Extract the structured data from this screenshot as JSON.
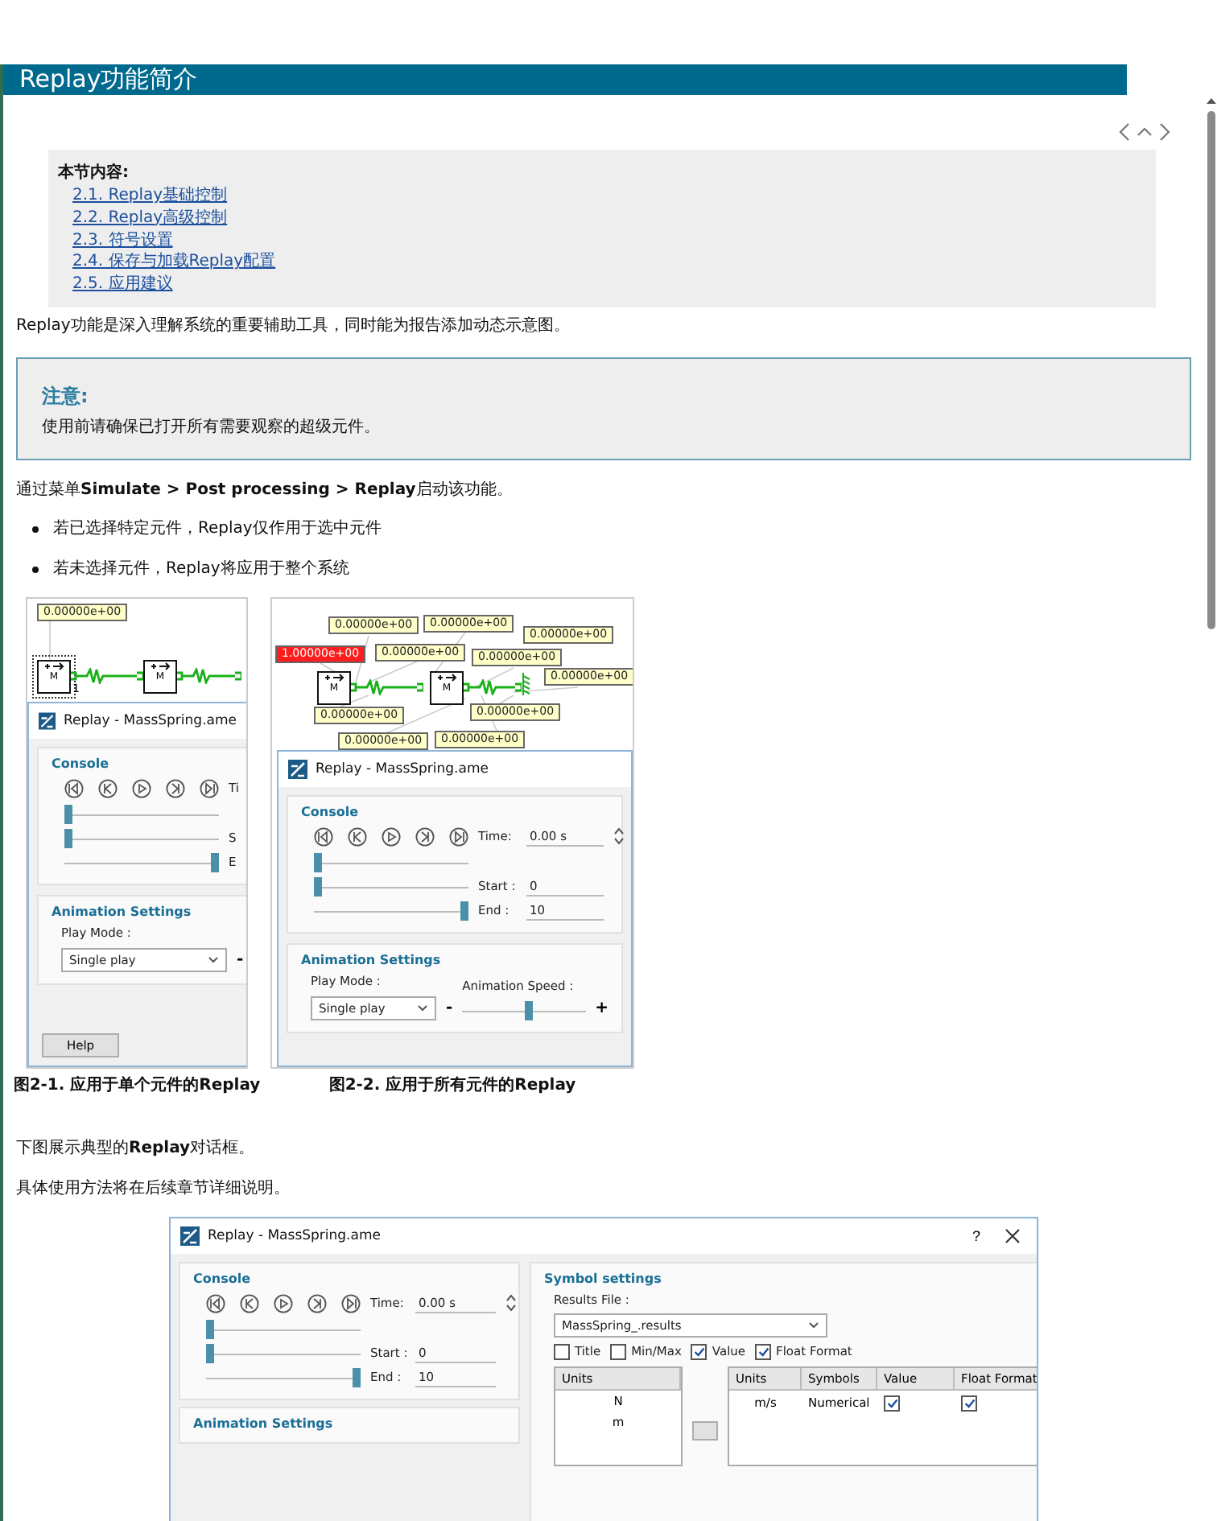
{
  "page_title": "Replay功能简介",
  "toc": {
    "heading": "本节内容:",
    "links": [
      "2.1. Replay基础控制",
      "2.2. Replay高级控制",
      "2.3. 符号设置",
      "2.4. 保存与加载Replay配置",
      "2.5. 应用建议"
    ]
  },
  "intro": "Replay功能是深入理解系统的重要辅助工具，同时能为报告添加动态示意图。",
  "note": {
    "title": "注意:",
    "text": "使用前请确保已打开所有需要观察的超级元件。"
  },
  "menu_path": "通过菜单**Simulate > Post processing > Replay**启动该功能。",
  "bullets": [
    "若已选择特定元件，Replay仅作用于选中元件",
    "若未选择元件，Replay将应用于整个系统"
  ],
  "figures": [
    {
      "caption": "图2-1. 应用于单个元件的Replay",
      "diagram": {
        "port_label": "1",
        "masses": [
          "M",
          "M"
        ],
        "values": [
          {
            "text": "0.00000e+00",
            "active": false
          }
        ]
      },
      "dialog": {
        "title": "Replay - MassSpring.ame",
        "close_button": false,
        "console": {
          "title": "Console",
          "time_label": "Ti",
          "start_label": "S",
          "end_label": "E",
          "sliders": [
            {
              "level": 0
            },
            {
              "level": 0
            },
            {
              "level": 1
            }
          ]
        },
        "animation": {
          "title": "Animation Settings",
          "play_mode_label": "Play Mode :",
          "play_mode": "Single play",
          "minus": "-"
        },
        "help_button": "Help"
      }
    },
    {
      "caption": "图2-2. 应用于所有元件的Replay",
      "diagram": {
        "masses": [
          "M",
          "M"
        ],
        "wall": true,
        "values": [
          {
            "text": "0.00000e+00",
            "active": false
          },
          {
            "text": "0.00000e+00",
            "active": false
          },
          {
            "text": "0.00000e+00",
            "active": false
          },
          {
            "text": "1.00000e+00",
            "active": true
          },
          {
            "text": "0.00000e+00",
            "active": false
          },
          {
            "text": "0.00000e+00",
            "active": false
          },
          {
            "text": "0.00000e+00",
            "active": false
          },
          {
            "text": "0.00000e+00",
            "active": false
          },
          {
            "text": "0.00000e+00",
            "active": false
          },
          {
            "text": "0.00000e+00",
            "active": false
          },
          {
            "text": "0.00000e+00",
            "active": false
          }
        ]
      },
      "dialog": {
        "title": "Replay - MassSpring.ame",
        "close_button": false,
        "console": {
          "title": "Console",
          "time_label": "Time:",
          "time_value": "0.00 s",
          "start_label": "Start :",
          "start_value": "0",
          "end_label": "End :",
          "end_value": "10",
          "sliders": [
            {
              "level": 0
            },
            {
              "level": 0
            },
            {
              "level": 1
            }
          ]
        },
        "animation": {
          "title": "Animation Settings",
          "play_mode_label": "Play Mode :",
          "play_mode": "Single play",
          "speed_label": "Animation Speed :",
          "minus": "-",
          "plus": "+",
          "speed_slider": {
            "level": 0.55
          }
        }
      }
    }
  ],
  "outro": [
    "下图展示典型的**Replay**对话框。",
    "具体使用方法将在后续章节详细说明。"
  ],
  "dialog": {
    "title": "Replay - MassSpring.ame",
    "help": "?",
    "close_button": true,
    "console": {
      "title": "Console",
      "time_label": "Time:",
      "time_value": "0.00 s",
      "start_label": "Start :",
      "start_value": "0",
      "end_label": "End :",
      "end_value": "10",
      "sliders": [
        {
          "level": 0
        },
        {
          "level": 0
        },
        {
          "level": 1
        }
      ]
    },
    "animation": {
      "title": "Animation Settings"
    },
    "symbols": {
      "title": "Symbol settings",
      "results_label": "Results File :",
      "results_file": "MassSpring_.results",
      "options": [
        {
          "label": "Title",
          "checked": false
        },
        {
          "label": "Min/Max",
          "checked": false
        },
        {
          "label": "Value",
          "checked": true
        },
        {
          "label": "Float Format",
          "checked": true
        }
      ],
      "units_list": {
        "header": "Units",
        "items": [
          "N",
          "m"
        ]
      },
      "table": {
        "columns": [
          "Units",
          "Symbols",
          "Value",
          "Float Format"
        ],
        "rows": [
          {
            "units": "m/s",
            "symbols": "Numerical",
            "value": true,
            "float_format": true
          }
        ]
      }
    }
  }
}
